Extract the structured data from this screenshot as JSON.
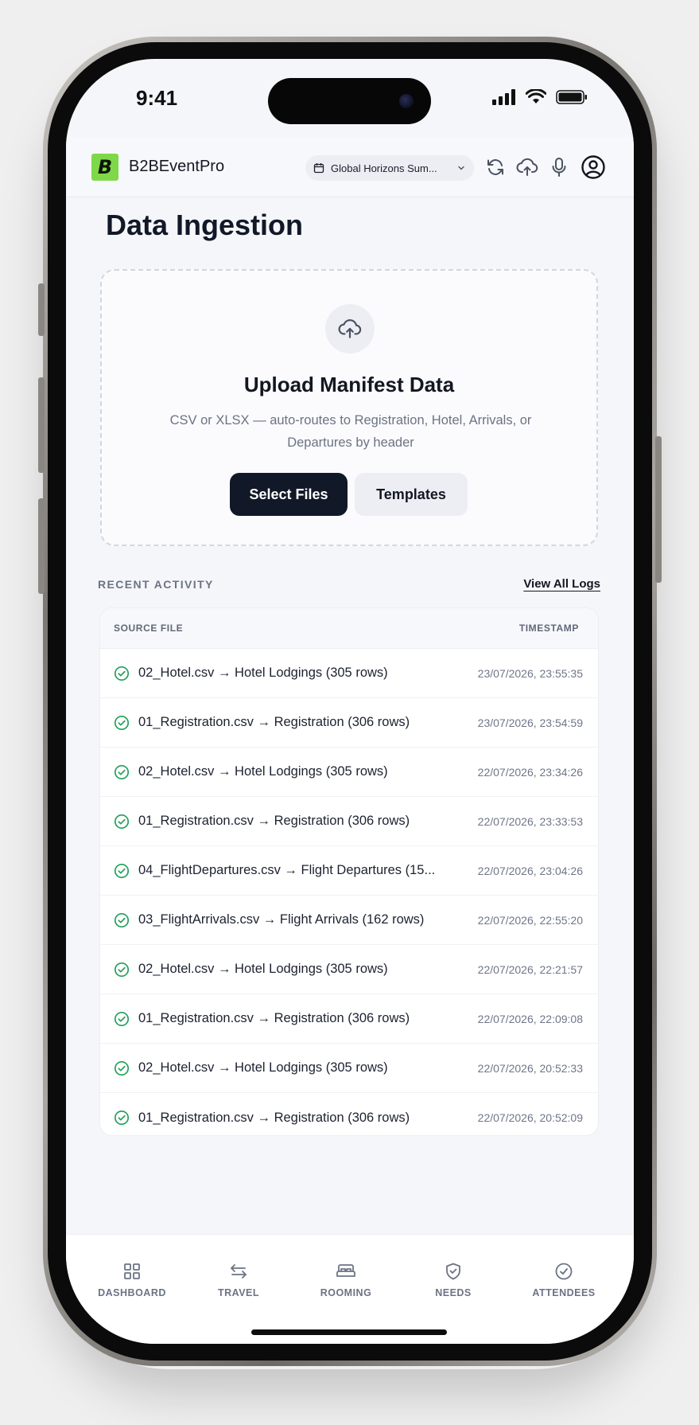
{
  "status_bar": {
    "time": "9:41"
  },
  "header": {
    "logo_letter": "B",
    "app_name": "B2BEventPro",
    "event_selector": "Global Horizons Sum...",
    "icons": [
      "refresh-icon",
      "cloud-upload-icon",
      "microphone-icon",
      "user-circle-icon"
    ]
  },
  "page": {
    "title": "Data Ingestion"
  },
  "upload": {
    "title": "Upload Manifest Data",
    "description": "CSV or XLSX — auto-routes to Registration, Hotel, Arrivals, or Departures by header",
    "select_files_label": "Select Files",
    "templates_label": "Templates"
  },
  "activity": {
    "section_label": "RECENT ACTIVITY",
    "view_all_label": "View All Logs",
    "columns": {
      "source": "SOURCE FILE",
      "timestamp": "TIMESTAMP"
    },
    "rows": [
      {
        "file": "02_Hotel.csv → Hotel Lodgings (305 rows)",
        "timestamp": "23/07/2026, 23:55:35"
      },
      {
        "file": "01_Registration.csv → Registration (306 rows)",
        "timestamp": "23/07/2026, 23:54:59"
      },
      {
        "file": "02_Hotel.csv → Hotel Lodgings (305 rows)",
        "timestamp": "22/07/2026, 23:34:26"
      },
      {
        "file": "01_Registration.csv → Registration (306 rows)",
        "timestamp": "22/07/2026, 23:33:53"
      },
      {
        "file": "04_FlightDepartures.csv → Flight Departures (15...",
        "timestamp": "22/07/2026, 23:04:26"
      },
      {
        "file": "03_FlightArrivals.csv → Flight Arrivals (162 rows)",
        "timestamp": "22/07/2026, 22:55:20"
      },
      {
        "file": "02_Hotel.csv → Hotel Lodgings (305 rows)",
        "timestamp": "22/07/2026, 22:21:57"
      },
      {
        "file": "01_Registration.csv → Registration (306 rows)",
        "timestamp": "22/07/2026, 22:09:08"
      },
      {
        "file": "02_Hotel.csv → Hotel Lodgings (305 rows)",
        "timestamp": "22/07/2026, 20:52:33"
      },
      {
        "file": "01_Registration.csv → Registration (306 rows)",
        "timestamp": "22/07/2026, 20:52:09"
      }
    ]
  },
  "bottom_nav": [
    {
      "label": "DASHBOARD",
      "icon": "grid-icon"
    },
    {
      "label": "TRAVEL",
      "icon": "arrows-swap-icon"
    },
    {
      "label": "ROOMING",
      "icon": "bed-icon"
    },
    {
      "label": "NEEDS",
      "icon": "shield-check-icon"
    },
    {
      "label": "ATTENDEES",
      "icon": "badge-check-icon"
    }
  ],
  "colors": {
    "accent": "#7fd84a",
    "primary": "#111827",
    "success": "#22a05a"
  }
}
